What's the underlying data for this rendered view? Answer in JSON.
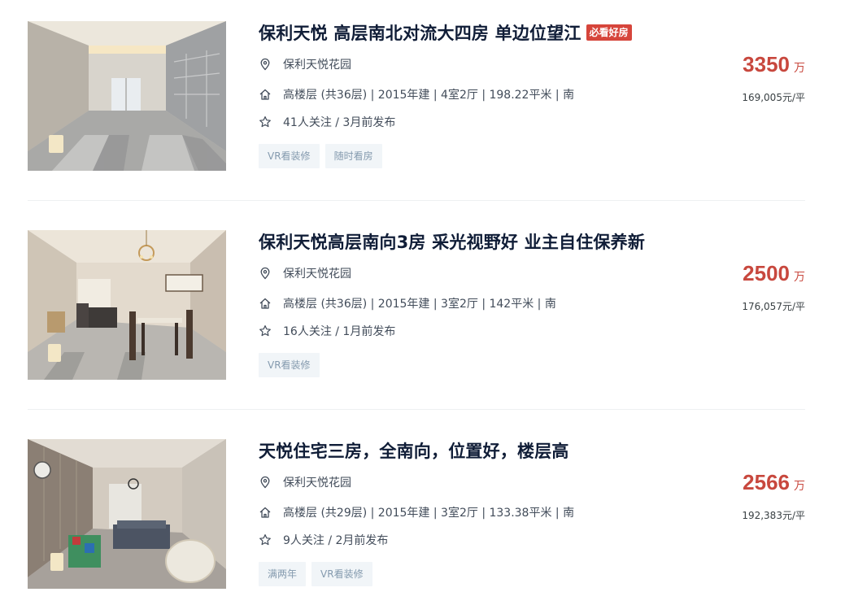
{
  "listings": [
    {
      "title": "保利天悦 高层南北对流大四房 单边位望江",
      "badge": "必看好房",
      "community": "保利天悦花园",
      "info": "高楼层 (共36层) | 2015年建 | 4室2厅 | 198.22平米 | 南",
      "follow": "41人关注 / 3月前发布",
      "tags": [
        "VR看装修",
        "随时看房"
      ],
      "total_price": "3350",
      "price_unit": "万",
      "unit_price": "169,005元/平"
    },
    {
      "title": "保利天悦高层南向3房 采光视野好 业主自住保养新",
      "badge": "",
      "community": "保利天悦花园",
      "info": "高楼层 (共36层) | 2015年建 | 3室2厅 | 142平米 | 南",
      "follow": "16人关注 / 1月前发布",
      "tags": [
        "VR看装修"
      ],
      "total_price": "2500",
      "price_unit": "万",
      "unit_price": "176,057元/平"
    },
    {
      "title": "天悦住宅三房，全南向，位置好，楼层高",
      "badge": "",
      "community": "保利天悦花园",
      "info": "高楼层 (共29层) | 2015年建 | 3室2厅 | 133.38平米 | 南",
      "follow": "9人关注 / 2月前发布",
      "tags": [
        "满两年",
        "VR看装修"
      ],
      "total_price": "2566",
      "price_unit": "万",
      "unit_price": "192,383元/平"
    }
  ],
  "colors": {
    "title": "#101d37",
    "price": "#c8483e",
    "badge_bg": "#d6453b",
    "tag_bg": "#f1f5f8",
    "tag_text": "#849aae",
    "meta_text": "#424c5a"
  },
  "icons": {
    "location": "location-pin-icon",
    "house": "house-icon",
    "star": "star-icon"
  }
}
